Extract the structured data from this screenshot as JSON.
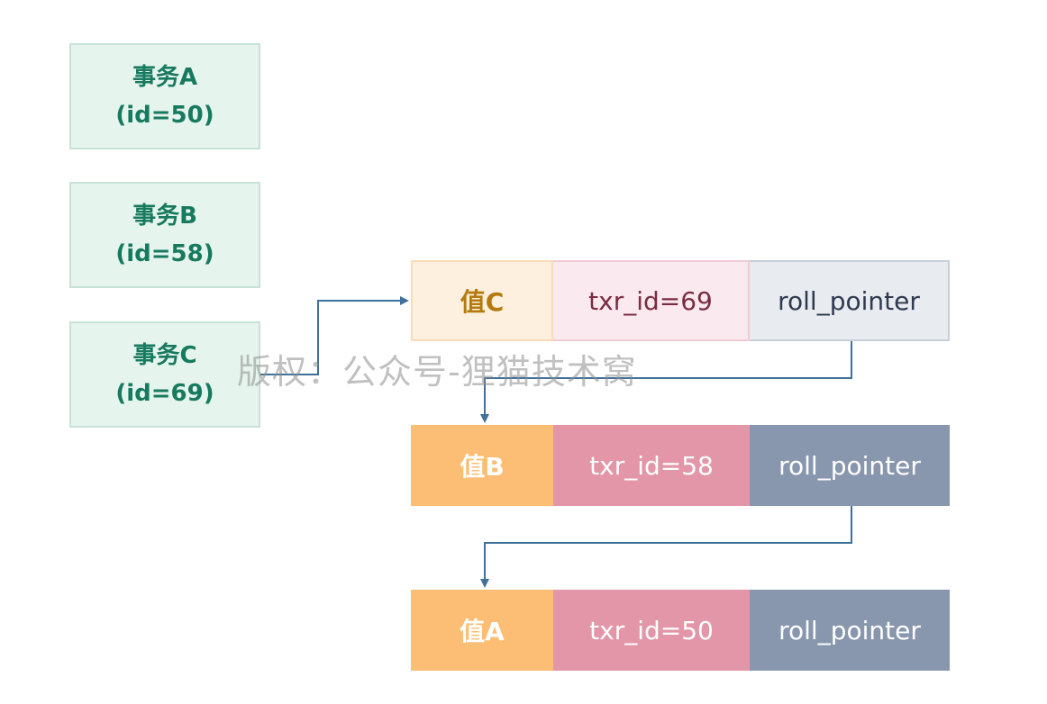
{
  "transactions": [
    {
      "name": "事务A",
      "id": "(id=50)"
    },
    {
      "name": "事务B",
      "id": "(id=58)"
    },
    {
      "name": "事务C",
      "id": "(id=69)"
    }
  ],
  "versions": [
    {
      "value": "值C",
      "txr_id": "txr_id=69",
      "pointer": "roll_pointer"
    },
    {
      "value": "值B",
      "txr_id": "txr_id=58",
      "pointer": "roll_pointer"
    },
    {
      "value": "值A",
      "txr_id": "txr_id=50",
      "pointer": "roll_pointer"
    }
  ],
  "watermark": "版权：公众号-狸猫技术窝",
  "colors": {
    "transaction_fill": "#e6f4ee",
    "transaction_text": "#177a5e",
    "value_cell": "#fbbe74",
    "txr_cell": "#e396a8",
    "pointer_cell": "#8897ad",
    "arrow": "#3f6f9a"
  }
}
